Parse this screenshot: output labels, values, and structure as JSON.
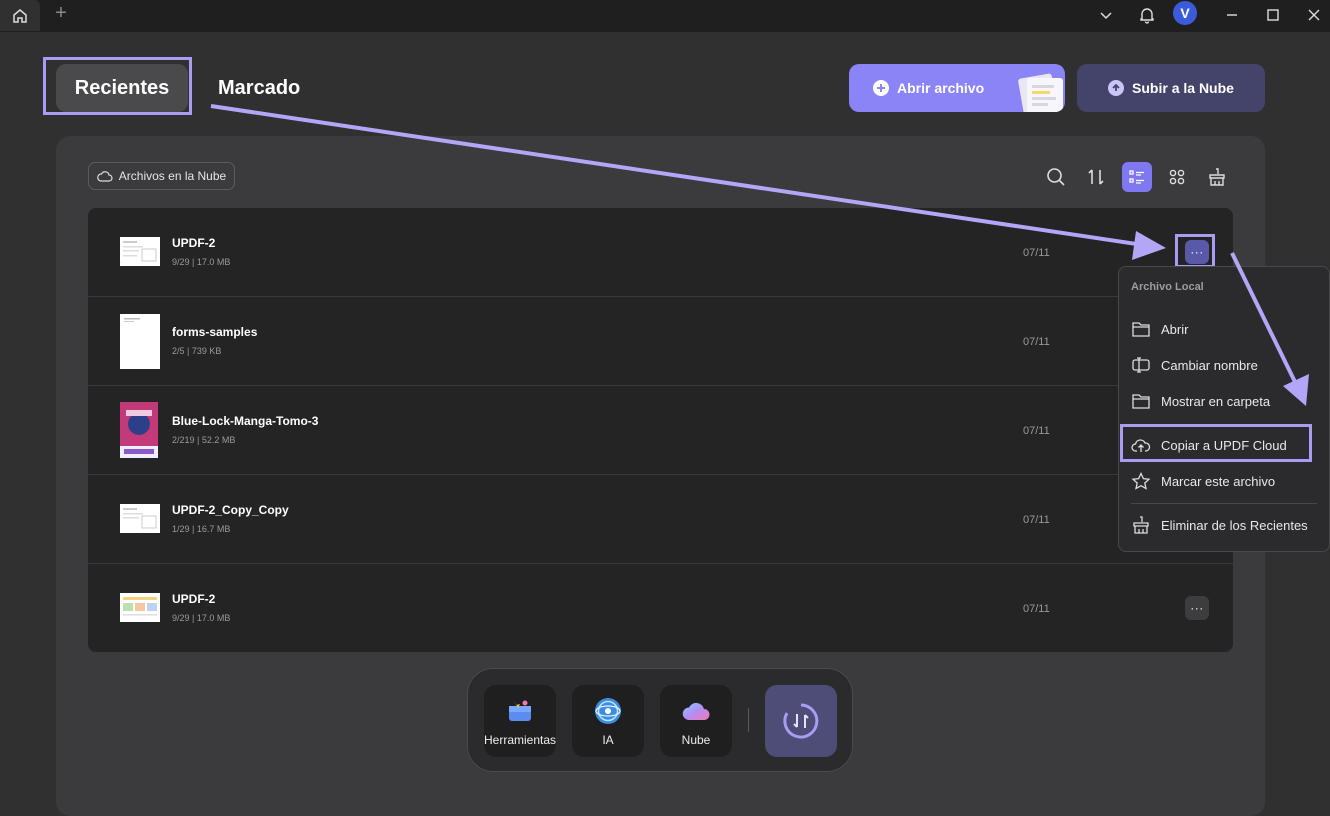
{
  "titlebar": {
    "add_tab": "+",
    "avatar_letter": "V"
  },
  "tabs": {
    "recientes": "Recientes",
    "marcado": "Marcado"
  },
  "actions": {
    "open_file": "Abrir archivo",
    "upload_cloud": "Subir a la Nube"
  },
  "filter": {
    "cloud_files": "Archivos en la Nube"
  },
  "files": [
    {
      "name": "UPDF-2",
      "meta": "9/29 | 17.0 MB",
      "date": "07/11"
    },
    {
      "name": "forms-samples",
      "meta": "2/5 | 739 KB",
      "date": "07/11"
    },
    {
      "name": "Blue-Lock-Manga-Tomo-3",
      "meta": "2/219 | 52.2 MB",
      "date": "07/11"
    },
    {
      "name": "UPDF-2_Copy_Copy",
      "meta": "1/29 | 16.7 MB",
      "date": "07/11"
    },
    {
      "name": "UPDF-2",
      "meta": "9/29 | 17.0 MB",
      "date": "07/11"
    }
  ],
  "more_label": "···",
  "context_menu": {
    "header": "Archivo Local",
    "items": {
      "abrir": "Abrir",
      "renombrar": "Cambiar nombre",
      "mostrar": "Mostrar en carpeta",
      "copiar": "Copiar a UPDF Cloud",
      "marcar": "Marcar este archivo",
      "eliminar": "Eliminar de los Recientes"
    }
  },
  "dock": {
    "herramientas": "Herramientas",
    "ia": "IA",
    "nube": "Nube"
  },
  "colors": {
    "accent": "#8b84f6",
    "highlight": "#a99cf3",
    "background": "#303031"
  }
}
